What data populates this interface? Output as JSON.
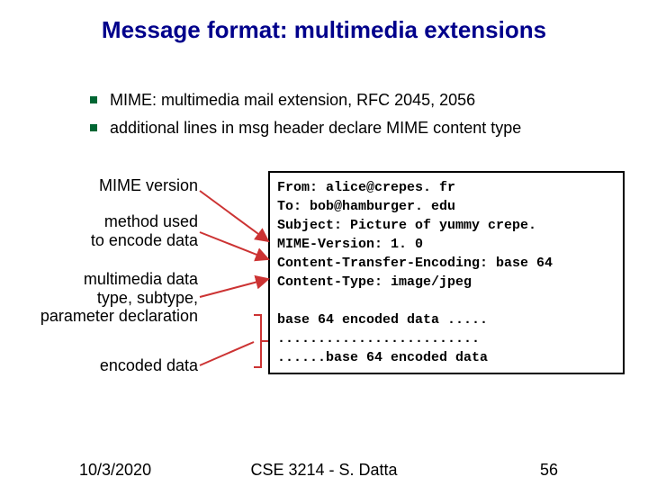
{
  "title": "Message format: multimedia extensions",
  "bullets": [
    "MIME: multimedia mail extension, RFC 2045, 2056",
    "additional lines in msg header declare MIME content type"
  ],
  "labels": {
    "mime_version": "MIME version",
    "method_used_l1": "method used",
    "method_used_l2": "to encode data",
    "multimedia_l1": "multimedia data",
    "multimedia_l2": "type, subtype,",
    "multimedia_l3": "parameter declaration",
    "encoded_data": "encoded data"
  },
  "email": {
    "from": "From: alice@crepes. fr",
    "to": "To: bob@hamburger. edu",
    "subject": "Subject: Picture of yummy crepe.",
    "mime": "MIME-Version: 1. 0",
    "cte": "Content-Transfer-Encoding: base 64",
    "ctype": "Content-Type: image/jpeg",
    "blank": " ",
    "body1": "base 64 encoded data .....",
    "body2": ".........................",
    "body3": "......base 64 encoded data"
  },
  "footer": {
    "date": "10/3/2020",
    "course": "CSE 3214 - S. Datta",
    "page": "56"
  }
}
